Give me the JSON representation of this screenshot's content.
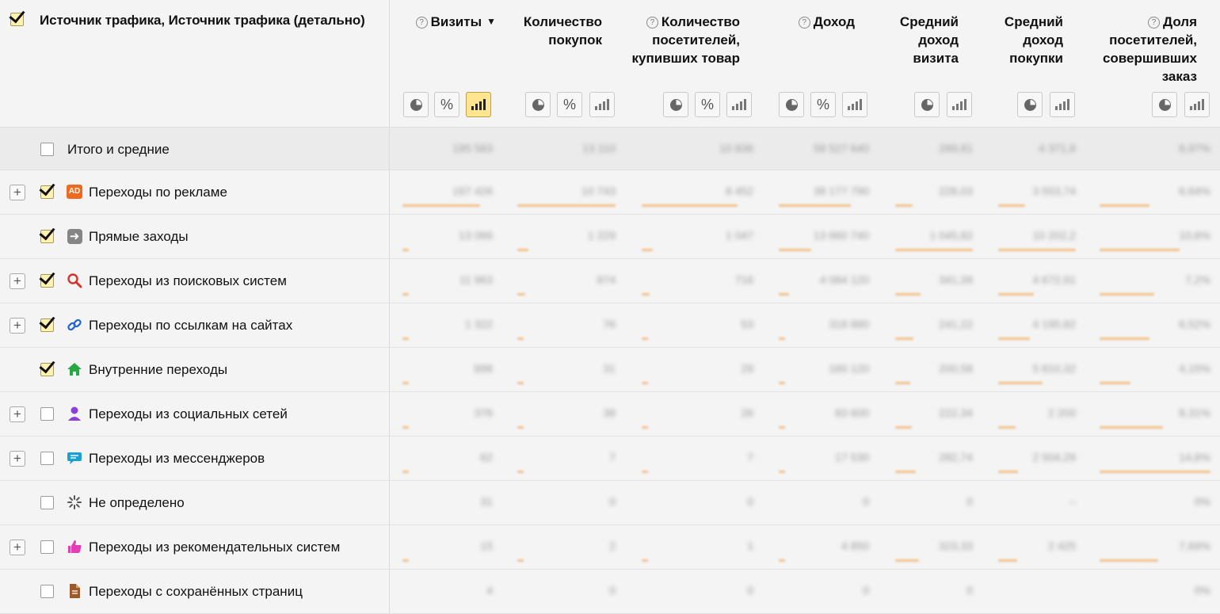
{
  "header": {
    "dimension_title": "Источник трафика, Источник трафика (детально)",
    "columns": [
      {
        "label": "Визиты",
        "help": true,
        "sorted": true
      },
      {
        "label": "Количество покупок"
      },
      {
        "label": "Количество посетителей, купивших товар",
        "help": true
      },
      {
        "label": "Доход",
        "help": true
      },
      {
        "label": "Средний доход визита"
      },
      {
        "label": "Средний доход покупки"
      },
      {
        "label": "Доля посетителей, совершивших заказ",
        "help": true
      }
    ],
    "sort_arrow": "▼",
    "help_glyph": "?",
    "percent_glyph": "%",
    "expand_glyph": "+"
  },
  "totals": {
    "label": "Итого и средние",
    "values": [
      "195 583",
      "13 110",
      "10 836",
      "58 527 640",
      "289,81",
      "4 371,8",
      "6,97%"
    ]
  },
  "rows": [
    {
      "label": "Переходы по рекламе",
      "icon": "ad-icon",
      "icon_text": "AD",
      "checked": true,
      "expandable": true,
      "values": [
        "167 426",
        "10 743",
        "8 452",
        "38 177 790",
        "228,03",
        "3 553,74",
        "6,64%"
      ]
    },
    {
      "label": "Прямые заходы",
      "icon": "arrow-right-icon",
      "checked": true,
      "expandable": false,
      "values": [
        "13 066",
        "1 229",
        "1 047",
        "13 660 740",
        "1 045,82",
        "10 202,2",
        "10,6%"
      ]
    },
    {
      "label": "Переходы из поисковых систем",
      "icon": "search-icon",
      "checked": true,
      "expandable": true,
      "values": [
        "11 963",
        "874",
        "716",
        "4 084 120",
        "341,39",
        "4 672,91",
        "7,2%"
      ]
    },
    {
      "label": "Переходы по ссылкам на сайтах",
      "icon": "link-icon",
      "checked": true,
      "expandable": true,
      "values": [
        "1 322",
        "76",
        "53",
        "318 880",
        "241,22",
        "4 195,82",
        "6,52%"
      ]
    },
    {
      "label": "Внутренние переходы",
      "icon": "home-icon",
      "checked": true,
      "expandable": false,
      "values": [
        "898",
        "31",
        "29",
        "180 120",
        "200,58",
        "5 810,32",
        "4,15%"
      ]
    },
    {
      "label": "Переходы из социальных сетей",
      "icon": "social-icon",
      "checked": false,
      "expandable": true,
      "values": [
        "376",
        "38",
        "26",
        "83 600",
        "222,34",
        "2 200",
        "8,31%"
      ]
    },
    {
      "label": "Переходы из мессенджеров",
      "icon": "message-icon",
      "checked": false,
      "expandable": true,
      "values": [
        "62",
        "7",
        "7",
        "17 530",
        "282,74",
        "2 504,29",
        "14,6%"
      ]
    },
    {
      "label": "Не определено",
      "icon": "undefined-icon",
      "checked": false,
      "expandable": false,
      "values": [
        "31",
        "0",
        "0",
        "0",
        "0",
        "–",
        "0%"
      ]
    },
    {
      "label": "Переходы из рекомендательных систем",
      "icon": "thumbs-up-icon",
      "checked": false,
      "expandable": true,
      "values": [
        "15",
        "2",
        "1",
        "4 850",
        "323,33",
        "2 425",
        "7,69%"
      ]
    },
    {
      "label": "Переходы с сохранённых страниц",
      "icon": "document-icon",
      "checked": false,
      "expandable": false,
      "values": [
        "4",
        "0",
        "0",
        "0",
        "0",
        "",
        "0%"
      ]
    }
  ],
  "bar_fractions": [
    [
      0.86,
      1.0,
      0.86,
      0.8,
      0.22,
      0.35,
      0.45
    ],
    [
      0.07,
      0.11,
      0.1,
      0.36,
      1.0,
      1.0,
      0.72
    ],
    [
      0.06,
      0.08,
      0.07,
      0.11,
      0.33,
      0.46,
      0.49
    ],
    [
      0.01,
      0.01,
      0.01,
      0.01,
      0.23,
      0.41,
      0.45
    ],
    [
      0.005,
      0.003,
      0.003,
      0.005,
      0.19,
      0.57,
      0.28
    ],
    [
      0.002,
      0.003,
      0.002,
      0.002,
      0.21,
      0.22,
      0.57
    ],
    [
      0.0005,
      0.0007,
      0.0007,
      0.0005,
      0.27,
      0.25,
      1.0
    ],
    [
      0,
      0,
      0,
      0,
      0,
      0,
      0
    ],
    [
      0.0001,
      0.0002,
      0.0001,
      0.0001,
      0.31,
      0.24,
      0.53
    ],
    [
      0,
      0,
      0,
      0,
      0,
      0,
      0
    ]
  ],
  "colors": {
    "accent": "#ffe590",
    "bar": "#f3c089",
    "checkbox_checked": "#fff2b3"
  }
}
